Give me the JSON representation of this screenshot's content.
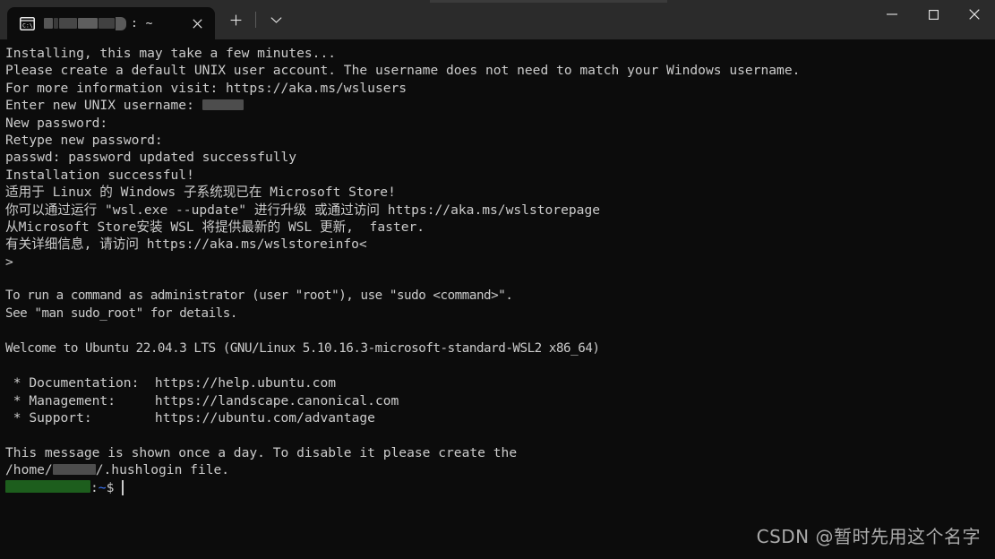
{
  "window": {
    "app_name": "Windows Terminal",
    "controls": {
      "minimize_label": "Minimize",
      "maximize_label": "Maximize",
      "close_label": "Close"
    }
  },
  "tabbar": {
    "tab": {
      "icon": "console-icon",
      "title_redacted": true,
      "title_suffix": ": ~",
      "close_label": "Close tab"
    },
    "new_tab_label": "+",
    "dropdown_label": "v"
  },
  "terminal": {
    "background_color": "#0c0c0c",
    "foreground_color": "#cccccc",
    "prompt": {
      "user_host_redacted": true,
      "colon": ":",
      "path": "~",
      "path_color": "#3b78ff",
      "sigil": "$"
    },
    "lines": [
      {
        "text": "Installing, this may take a few minutes..."
      },
      {
        "text": "Please create a default UNIX user account. The username does not need to match your Windows username."
      },
      {
        "text": "For more information visit: https://aka.ms/wslusers"
      },
      {
        "text": "Enter new UNIX username: ",
        "redact": "gray",
        "redact_width": 46
      },
      {
        "text": "New password:"
      },
      {
        "text": "Retype new password:"
      },
      {
        "text": "passwd: password updated successfully"
      },
      {
        "text": "Installation successful!"
      },
      {
        "text": "适用于 Linux 的 Windows 子系统现已在 Microsoft Store!"
      },
      {
        "text": "你可以通过运行 \"wsl.exe --update\" 进行升级 或通过访问 https://aka.ms/wslstorepage"
      },
      {
        "text": "从Microsoft Store安装 WSL 将提供最新的 WSL 更新,  faster."
      },
      {
        "text": "有关详细信息, 请访问 https://aka.ms/wslstoreinfo<"
      },
      {
        "text": ">"
      },
      {
        "text": ""
      },
      {
        "text": "To run a command as administrator (user \"root\"), use \"sudo <command>\".",
        "narrow": true
      },
      {
        "text": "See \"man sudo_root\" for details.",
        "narrow": true
      },
      {
        "text": ""
      },
      {
        "text": "Welcome to Ubuntu 22.04.3 LTS (GNU/Linux 5.10.16.3-microsoft-standard-WSL2 x86_64)",
        "narrow": true
      },
      {
        "text": ""
      },
      {
        "text": " * Documentation:  https://help.ubuntu.com"
      },
      {
        "text": " * Management:     https://landscape.canonical.com"
      },
      {
        "text": " * Support:        https://ubuntu.com/advantage"
      },
      {
        "text": ""
      },
      {
        "text": "This message is shown once a day. To disable it please create the"
      },
      {
        "text": "/home/",
        "redact": "gray",
        "redact_width": 48,
        "text_after": "/.hushlogin file."
      }
    ]
  },
  "watermark": {
    "text": "CSDN @暂时先用这个名字"
  }
}
